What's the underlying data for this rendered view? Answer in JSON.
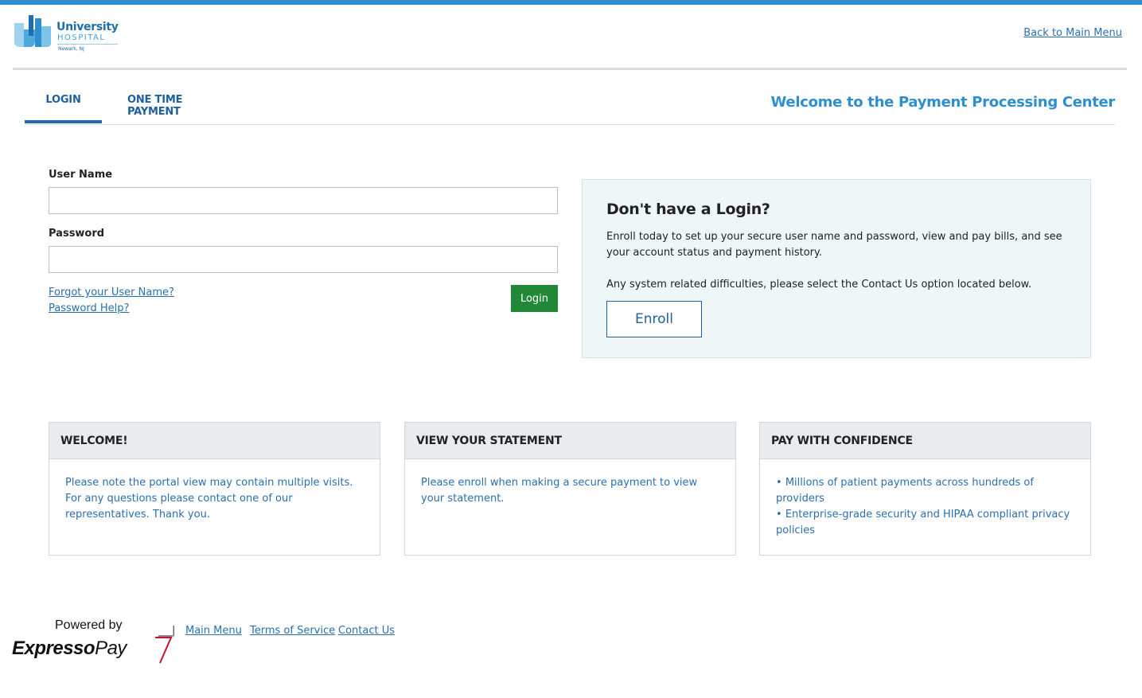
{
  "brand": {
    "logo_name": "University",
    "logo_sub": "HOSPITAL",
    "logo_location": "Newark, NJ"
  },
  "header": {
    "back_link": "Back to Main Menu"
  },
  "tabs": [
    {
      "label": "LOGIN",
      "active": true
    },
    {
      "label": "ONE TIME PAYMENT",
      "active": false
    }
  ],
  "welcome_title": "Welcome to the Payment Processing Center",
  "login_form": {
    "username_label": "User Name",
    "username_value": "",
    "password_label": "Password",
    "password_value": "",
    "forgot_username": "Forgot your User Name?",
    "password_help": "Password Help?",
    "login_button": "Login"
  },
  "enroll": {
    "title": "Don't have a Login?",
    "text_1": "Enroll today to set up your secure user name and password, view and pay bills, and see your account status and payment history.",
    "text_2": "Any system related difficulties, please select the Contact Us option located below.",
    "button": "Enroll"
  },
  "cards": [
    {
      "title": "WELCOME!",
      "body": "Please note the portal view may contain multiple visits. For any questions please contact one of our representatives. Thank you."
    },
    {
      "title": "VIEW YOUR STATEMENT",
      "body": "Please enroll when making a secure payment to view your statement."
    },
    {
      "title": "PAY WITH CONFIDENCE",
      "items": [
        "Millions of patient payments across hundreds of providers",
        "Enterprise-grade security and HIPAA compliant privacy policies"
      ]
    }
  ],
  "footer": {
    "powered_by": "Powered by",
    "brand_bold": "Expresso",
    "brand_light": "Pay",
    "separator": "|",
    "links": [
      "Main Menu",
      "Terms of Service",
      "Contact Us"
    ]
  },
  "colors": {
    "accent_blue": "#2f8fce",
    "link_blue": "#2a6fae",
    "login_green": "#218838",
    "enroll_bg": "#eef6f8"
  }
}
